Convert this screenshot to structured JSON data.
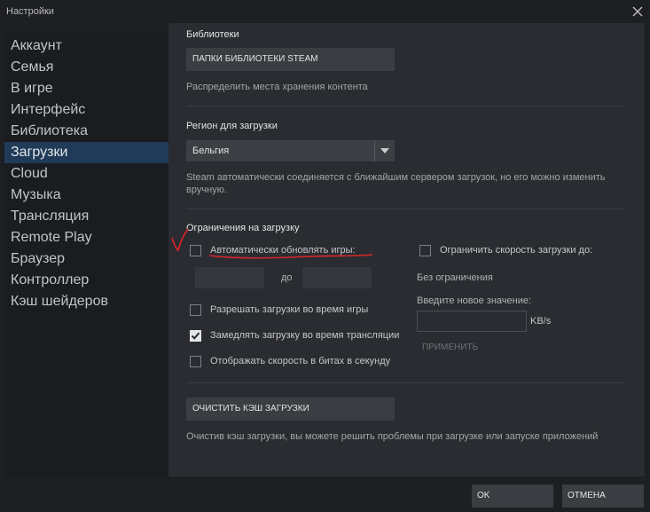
{
  "window": {
    "title": "Настройки"
  },
  "sidebar": {
    "items": [
      {
        "label": "Аккаунт"
      },
      {
        "label": "Семья"
      },
      {
        "label": "В игре"
      },
      {
        "label": "Интерфейс"
      },
      {
        "label": "Библиотека"
      },
      {
        "label": "Загрузки",
        "active": true
      },
      {
        "label": "Cloud"
      },
      {
        "label": "Музыка"
      },
      {
        "label": "Трансляция"
      },
      {
        "label": "Remote Play"
      },
      {
        "label": "Браузер"
      },
      {
        "label": "Контроллер"
      },
      {
        "label": "Кэш шейдеров"
      }
    ]
  },
  "libraries": {
    "title": "Библиотеки",
    "button_label": "ПАПКИ БИБЛИОТЕКИ STEAM",
    "description": "Распределить места хранения контента"
  },
  "region": {
    "title": "Регион для загрузки",
    "selected": "Бельгия",
    "description": "Steam автоматически соединяется с ближайшим сервером загрузок, но его можно изменить вручную."
  },
  "restrictions": {
    "title": "Ограничения на загрузку",
    "auto_update_label": "Автоматически обновлять игры:",
    "auto_update_checked": false,
    "time_separator": "до",
    "allow_during_game_label": "Разрешать загрузки во время игры",
    "allow_during_game_checked": false,
    "throttle_streaming_label": "Замедлять загрузку во время трансляции",
    "throttle_streaming_checked": true,
    "bits_label": "Отображать скорость в битах в секунду",
    "bits_checked": false,
    "limit_speed_label": "Ограничить скорость загрузки до:",
    "limit_speed_checked": false,
    "no_limit_text": "Без ограничения",
    "new_value_label": "Введите новое значение:",
    "unit": "KB/s",
    "apply_label": "ПРИМЕНИТЬ"
  },
  "cache": {
    "button_label": "ОЧИСТИТЬ КЭШ ЗАГРУЗКИ",
    "description": "Очистив кэш загрузки, вы можете решить проблемы при загрузке или запуске приложений"
  },
  "footer": {
    "ok_label": "OK",
    "cancel_label": "ОТМЕНА"
  },
  "colors": {
    "active_nav": "#1f3b57",
    "annotation": "#d9262c"
  }
}
